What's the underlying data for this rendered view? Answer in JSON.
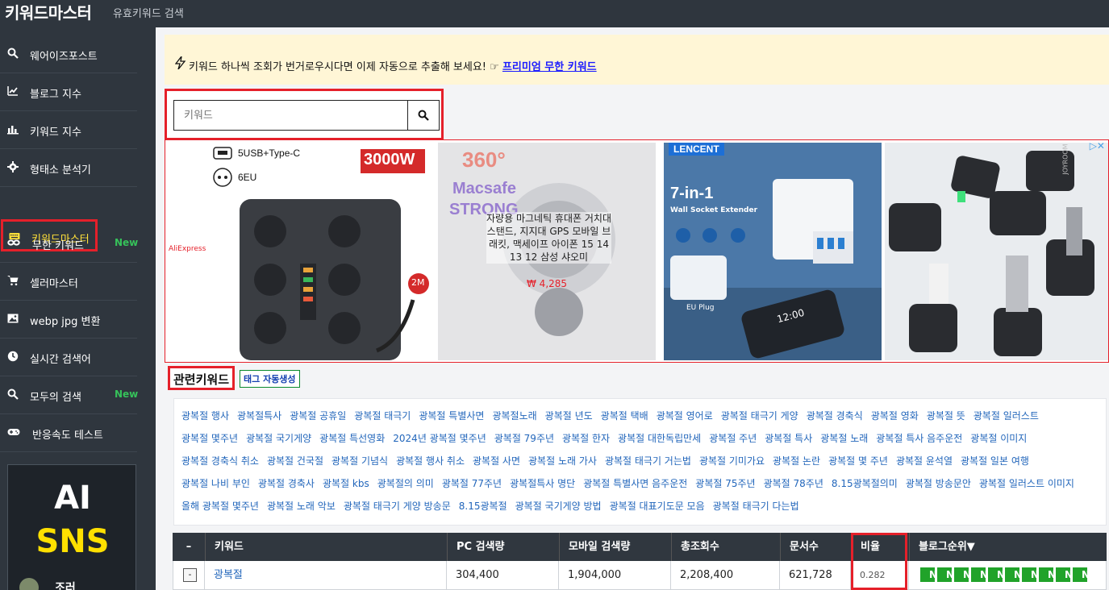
{
  "header": {
    "title": "키워드마스터",
    "subtitle": "유효키워드 검색"
  },
  "sidebar": {
    "items": [
      {
        "label": "웨어이즈포스트",
        "icon": "search-icon"
      },
      {
        "label": "블로그 지수",
        "icon": "line-chart-icon"
      },
      {
        "label": "키워드 지수",
        "icon": "bar-chart-icon"
      },
      {
        "label": "형태소 분석기",
        "icon": "gear-icon"
      },
      {
        "label": "키워드마스터",
        "icon": "keyboard-icon",
        "active": true
      },
      {
        "label": "무한 키워드",
        "icon": "infinity-icon",
        "badge": "New"
      },
      {
        "label": "셀러마스터",
        "icon": "cart-icon"
      },
      {
        "label": "webp jpg 변환",
        "icon": "image-icon"
      },
      {
        "label": "실시간 검색어",
        "icon": "clock-icon"
      },
      {
        "label": "모두의 검색",
        "icon": "search-icon",
        "badge": "New"
      },
      {
        "label": "반응속도 테스트",
        "icon": "gamepad-icon"
      }
    ],
    "promo": {
      "line1": "AI",
      "line2": "SNS",
      "footer": "조러"
    }
  },
  "notice": {
    "text": "키워드 하나씩 조회가 번거로우시다면 이제 자동으로 추출해 보세요! ☞ ",
    "link": "프리미엄 무한 키워드"
  },
  "search": {
    "placeholder": "키워드",
    "value": ""
  },
  "ad": {
    "source": "AliExpress",
    "tile1": {
      "spec1": "5USB+Type-C",
      "spec2": "6EU",
      "badge": "3000W",
      "cable": "2M"
    },
    "tile2": {
      "heading": "360°",
      "brand1": "Macsafe",
      "brand2": "STRONG",
      "desc": "자량용 마그네틱 휴대폰 거치대 스탠드, 지지대 GPS 모바일 브래킷, 맥세이프 아이폰 15 14 13 12 삼성 샤오미",
      "price": "₩ 4,285"
    },
    "tile3": {
      "brand": "LENCENT",
      "title": "7-in-1",
      "subtitle": "Wall Socket Extender",
      "plug": "EU Plug",
      "time": "12:00"
    },
    "tile4": {
      "brand": "JOYROOM"
    }
  },
  "related": {
    "title": "관련키워드",
    "tag_button": "태그 자동생성",
    "rows": [
      [
        "광복절 행사",
        "광복절특사",
        "광복절 공휴일",
        "광복절 태극기",
        "광복절 특별사면",
        "광복절노래",
        "광복절 년도",
        "광복절 택배",
        "광복절 영어로",
        "광복절 태극기 게양",
        "광복절 경축식",
        "광복절 영화",
        "광복절 뜻",
        "광복절 일러스트"
      ],
      [
        "광복절 몇주년",
        "광복절 국기게양",
        "광복절 특선영화",
        "2024년 광복절 몇주년",
        "광복절 79주년",
        "광복절 한자",
        "광복절 대한독립만세",
        "광복절 주년",
        "광복절 특사",
        "광복절 노래",
        "광복절 특사 음주운전",
        "광복절 이미지"
      ],
      [
        "광복절 경축식 취소",
        "광복절 건국절",
        "광복절 기념식",
        "광복절 행사 취소",
        "광복절 사면",
        "광복절 노래 가사",
        "광복절 태극기 거는법",
        "광복절 기미가요",
        "광복절 논란",
        "광복절 몇 주년",
        "광복절 윤석열",
        "광복절 일본 여행"
      ],
      [
        "광복절 나비 부인",
        "광복절 경축사",
        "광복절 kbs",
        "광복절의 의미",
        "광복절 77주년",
        "광복절특사 명단",
        "광복절 특별사면 음주운전",
        "광복절 75주년",
        "광복절 78주년",
        "8.15광복절의미",
        "광복절 방송문안",
        "광복절 일러스트 이미지"
      ],
      [
        "올해 광복절 몇주년",
        "광복절 노래 악보",
        "광복절 태극기 게양 방송문",
        "8.15광복절",
        "광복절 국기게양 방법",
        "광복절 대표기도문 모음",
        "광복절 태극기 다는법"
      ]
    ]
  },
  "table": {
    "headers": [
      "–",
      "키워드",
      "PC 검색량",
      "모바일 검색량",
      "총조회수",
      "문서수",
      "비율",
      "블로그순위▼"
    ],
    "row": {
      "minus": "-",
      "keyword": "광복절",
      "pc": "304,400",
      "mobile": "1,904,000",
      "total": "2,208,400",
      "docs": "621,728",
      "ratio": "0.282",
      "blog_rank": [
        "N",
        "N",
        "N",
        "N",
        "N",
        "N",
        "N",
        "N",
        "N",
        "N"
      ]
    }
  },
  "colors": {
    "accent": "#e5202a",
    "sidebar": "#2f363e",
    "link": "#2266bb",
    "new_badge": "#36c25a",
    "rank_badge": "#21a32a"
  }
}
